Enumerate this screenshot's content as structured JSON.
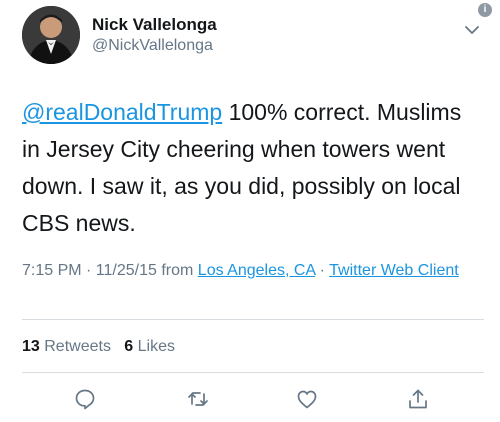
{
  "user": {
    "display_name": "Nick Vallelonga",
    "handle": "@NickVallelonga"
  },
  "tweet": {
    "mention": "@realDonaldTrump",
    "text": " 100% correct.  Muslims in Jersey City cheering when towers went down. I saw it, as you did, possibly on local CBS news."
  },
  "meta": {
    "time": "7:15 PM · 11/25/15 from",
    "location": "Los Angeles, CA",
    "separator": "·",
    "client": "Twitter Web Client"
  },
  "stats": {
    "retweets_count": "13",
    "retweets_label": "Retweets",
    "likes_count": "6",
    "likes_label": "Likes"
  },
  "badge": {
    "label": "i"
  },
  "icons": {
    "caret": "chevron-down-icon",
    "reply": "reply-icon",
    "retweet": "retweet-icon",
    "like": "heart-icon",
    "share": "share-icon"
  },
  "colors": {
    "accent": "#1b95e0",
    "text_primary": "#14171a",
    "text_secondary": "#657786",
    "divider": "#d7dde1"
  }
}
